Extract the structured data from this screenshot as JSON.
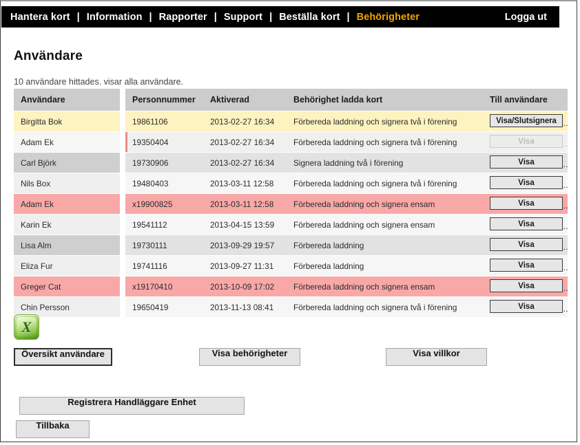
{
  "nav": {
    "items": [
      {
        "label": "Hantera kort",
        "active": false
      },
      {
        "label": "Information",
        "active": false
      },
      {
        "label": "Rapporter",
        "active": false
      },
      {
        "label": "Support",
        "active": false
      },
      {
        "label": "Beställa kort",
        "active": false
      },
      {
        "label": "Behörigheter",
        "active": true
      }
    ],
    "separator": "|",
    "logout_label": "Logga ut",
    "active_color": "#f0a500"
  },
  "page": {
    "title": "Användare",
    "status": "10 användare hittades. visar alla användare."
  },
  "table": {
    "headers": {
      "name": "Användare",
      "personnummer": "Personnummer",
      "activated": "Aktiverad",
      "permission": "Behörighet ladda kort",
      "action": "Till användare"
    },
    "rows": [
      {
        "name": "Birgitta Bok",
        "personnummer": "19861106",
        "activated": "2013-02-27 16:34",
        "permission": "Förbereda laddning och signera två i förening",
        "button_label": "Visa/Slutsignera",
        "button_disabled": false,
        "highlight": "yellow",
        "marker": false
      },
      {
        "name": "Adam Ek",
        "personnummer": "19350404",
        "activated": "2013-02-27 16:34",
        "permission": "Förbereda laddning och signera två i förening",
        "button_label": "Visa",
        "button_disabled": true,
        "highlight": "pending",
        "marker": true
      },
      {
        "name": "Carl Björk",
        "personnummer": "19730906",
        "activated": "2013-02-27 16:34",
        "permission": "Signera laddning två i förening",
        "button_label": "Visa",
        "button_disabled": false,
        "highlight": "dark",
        "marker": false
      },
      {
        "name": "Nils Box",
        "personnummer": "19480403",
        "activated": "2013-03-11 12:58",
        "permission": "Förbereda laddning och signera två i förening",
        "button_label": "Visa",
        "button_disabled": false,
        "highlight": "light",
        "marker": false
      },
      {
        "name": "Adam Ek",
        "personnummer": "x19900825",
        "activated": "2013-03-11 12:58",
        "permission": "Förbereda laddning och signera ensam",
        "button_label": "Visa",
        "button_disabled": false,
        "highlight": "red",
        "marker": false
      },
      {
        "name": "Karin Ek",
        "personnummer": "19541112",
        "activated": "2013-04-15 13:59",
        "permission": "Förbereda laddning och signera ensam",
        "button_label": "Visa",
        "button_disabled": false,
        "highlight": "light",
        "marker": false
      },
      {
        "name": "Lisa Alm",
        "personnummer": "19730111",
        "activated": "2013-09-29 19:57",
        "permission": "Förbereda laddning",
        "button_label": "Visa",
        "button_disabled": false,
        "highlight": "dark",
        "marker": false
      },
      {
        "name": "Eliza Fur",
        "personnummer": "19741116",
        "activated": "2013-09-27 11:31",
        "permission": "Förbereda laddning",
        "button_label": "Visa",
        "button_disabled": false,
        "highlight": "light",
        "marker": false
      },
      {
        "name": "Greger Cat",
        "personnummer": "x19170410",
        "activated": "2013-10-09 17:02",
        "permission": "Förbereda laddning och signera ensam",
        "button_label": "Visa",
        "button_disabled": false,
        "highlight": "red",
        "marker": false
      },
      {
        "name": "Chin Persson",
        "personnummer": "19650419",
        "activated": "2013-11-13 08:41",
        "permission": "Förbereda laddning och signera två i förening",
        "button_label": "Visa",
        "button_disabled": false,
        "highlight": "light",
        "marker": false
      }
    ]
  },
  "export": {
    "icon": "excel-export-icon",
    "glyph": "X"
  },
  "actions": {
    "oversikt": "Översikt användare",
    "behorigheter": "Visa behörigheter",
    "villkor": "Visa villkor",
    "registrera": "Registrera Handläggare Enhet",
    "tillbaka": "Tillbaka"
  },
  "colors": {
    "navbar_bg": "#000000",
    "nav_active": "#f0a500",
    "header_bg": "#cccccc",
    "row_highlight_yellow": "#fdf3c0",
    "row_highlight_red": "#f9a8a8",
    "row_marker_red": "#f08a8a"
  }
}
